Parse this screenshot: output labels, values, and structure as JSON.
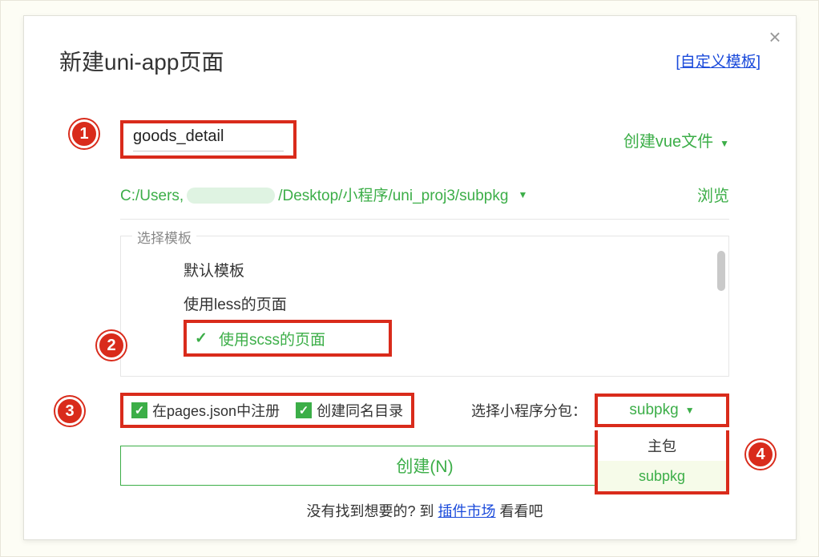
{
  "dialog": {
    "title": "新建uni-app页面",
    "custom_template_link": "自定义模板"
  },
  "input": {
    "page_name_value": "goods_detail",
    "file_type_dropdown": "创建vue文件"
  },
  "path": {
    "prefix": "C:/Users,",
    "suffix": "/Desktop/小程序/uni_proj3/subpkg",
    "browse_label": "浏览"
  },
  "template": {
    "legend": "选择模板",
    "items": [
      "默认模板",
      "使用less的页面"
    ],
    "selected": "使用scss的页面"
  },
  "options": {
    "register_in_pages": "在pages.json中注册",
    "create_same_dir": "创建同名目录",
    "subpkg_label": "选择小程序分包：",
    "subpkg_selected": "subpkg",
    "subpkg_options": [
      "主包",
      "subpkg"
    ]
  },
  "buttons": {
    "create": "创建(N)"
  },
  "footer": {
    "text_before": "没有找到想要的? 到 ",
    "link": "插件市场",
    "text_after": " 看看吧"
  },
  "annotations": {
    "1": "1",
    "2": "2",
    "3": "3",
    "4": "4"
  }
}
